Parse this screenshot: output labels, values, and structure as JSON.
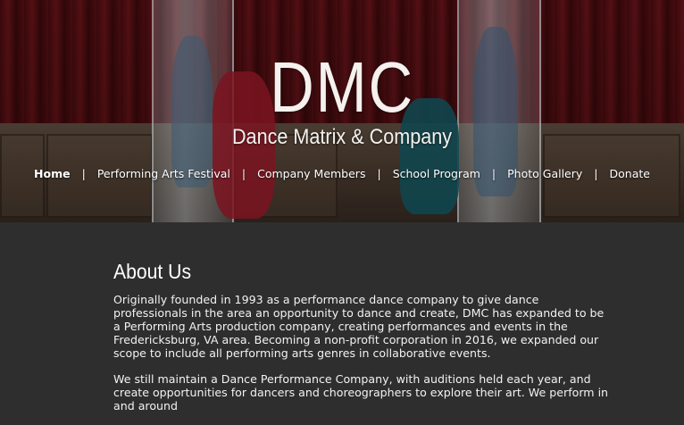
{
  "brand": {
    "title": "DMC",
    "subtitle": "Dance Matrix & Company"
  },
  "nav": {
    "items": [
      {
        "label": "Home",
        "active": true
      },
      {
        "label": "Performing Arts Festival",
        "active": false
      },
      {
        "label": "Company Members",
        "active": false
      },
      {
        "label": "School Program",
        "active": false
      },
      {
        "label": "Photo Gallery",
        "active": false
      },
      {
        "label": "Donate",
        "active": false
      }
    ],
    "separator": "|"
  },
  "about": {
    "heading": "About Us",
    "paragraphs": [
      "Originally founded in 1993 as a performance dance company to give dance professionals in the area an opportunity to dance and create, DMC has expanded to be a Performing Arts production company, creating performances and events in the Fredericksburg, VA area. Becoming a non-profit corporation in 2016, we expanded our scope to include all performing arts genres in collaborative events.",
      "We still maintain a Dance Performance Company, with auditions held each year, and create opportunities for dancers and choreographers to explore their art. We perform in and around"
    ]
  },
  "colors": {
    "page_background": "#2e2e2e",
    "hero_curtain": "#5a1015",
    "text": "#ffffff"
  }
}
